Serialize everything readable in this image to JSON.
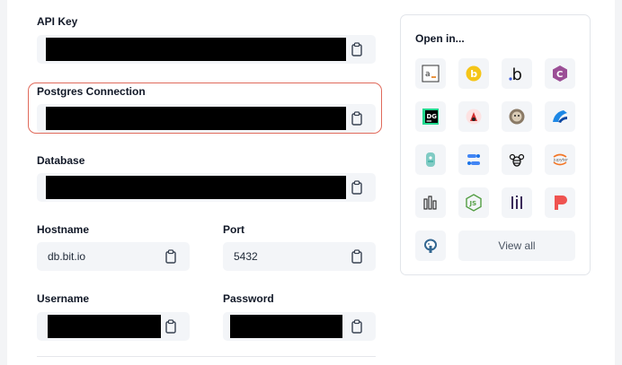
{
  "fields": {
    "api_key_label": "API Key",
    "postgres_label": "Postgres Connection",
    "database_label": "Database",
    "hostname_label": "Hostname",
    "hostname_value": "db.bit.io",
    "port_label": "Port",
    "port_value": "5432",
    "username_label": "Username",
    "password_label": "Password"
  },
  "open_in": {
    "title": "Open in...",
    "view_all_label": "View all",
    "apps": [
      "amazon-app",
      "bit-coin-app",
      "bit-io-app",
      "csharp-app",
      "datagrip-app",
      "python-scorpion-app",
      "beaver-app",
      "dbeaver-app",
      "fishbowl-app",
      "google-datastudio-app",
      "bee-app",
      "jupyter-app",
      "powerbi-app",
      "nodejs-app",
      "metabase-app",
      "parabola-app",
      "postgres-elephant-app"
    ]
  },
  "colors": {
    "highlight_border": "#e06a5b",
    "field_bg": "#f3f5f8",
    "panel_border": "#e2e5ea"
  }
}
